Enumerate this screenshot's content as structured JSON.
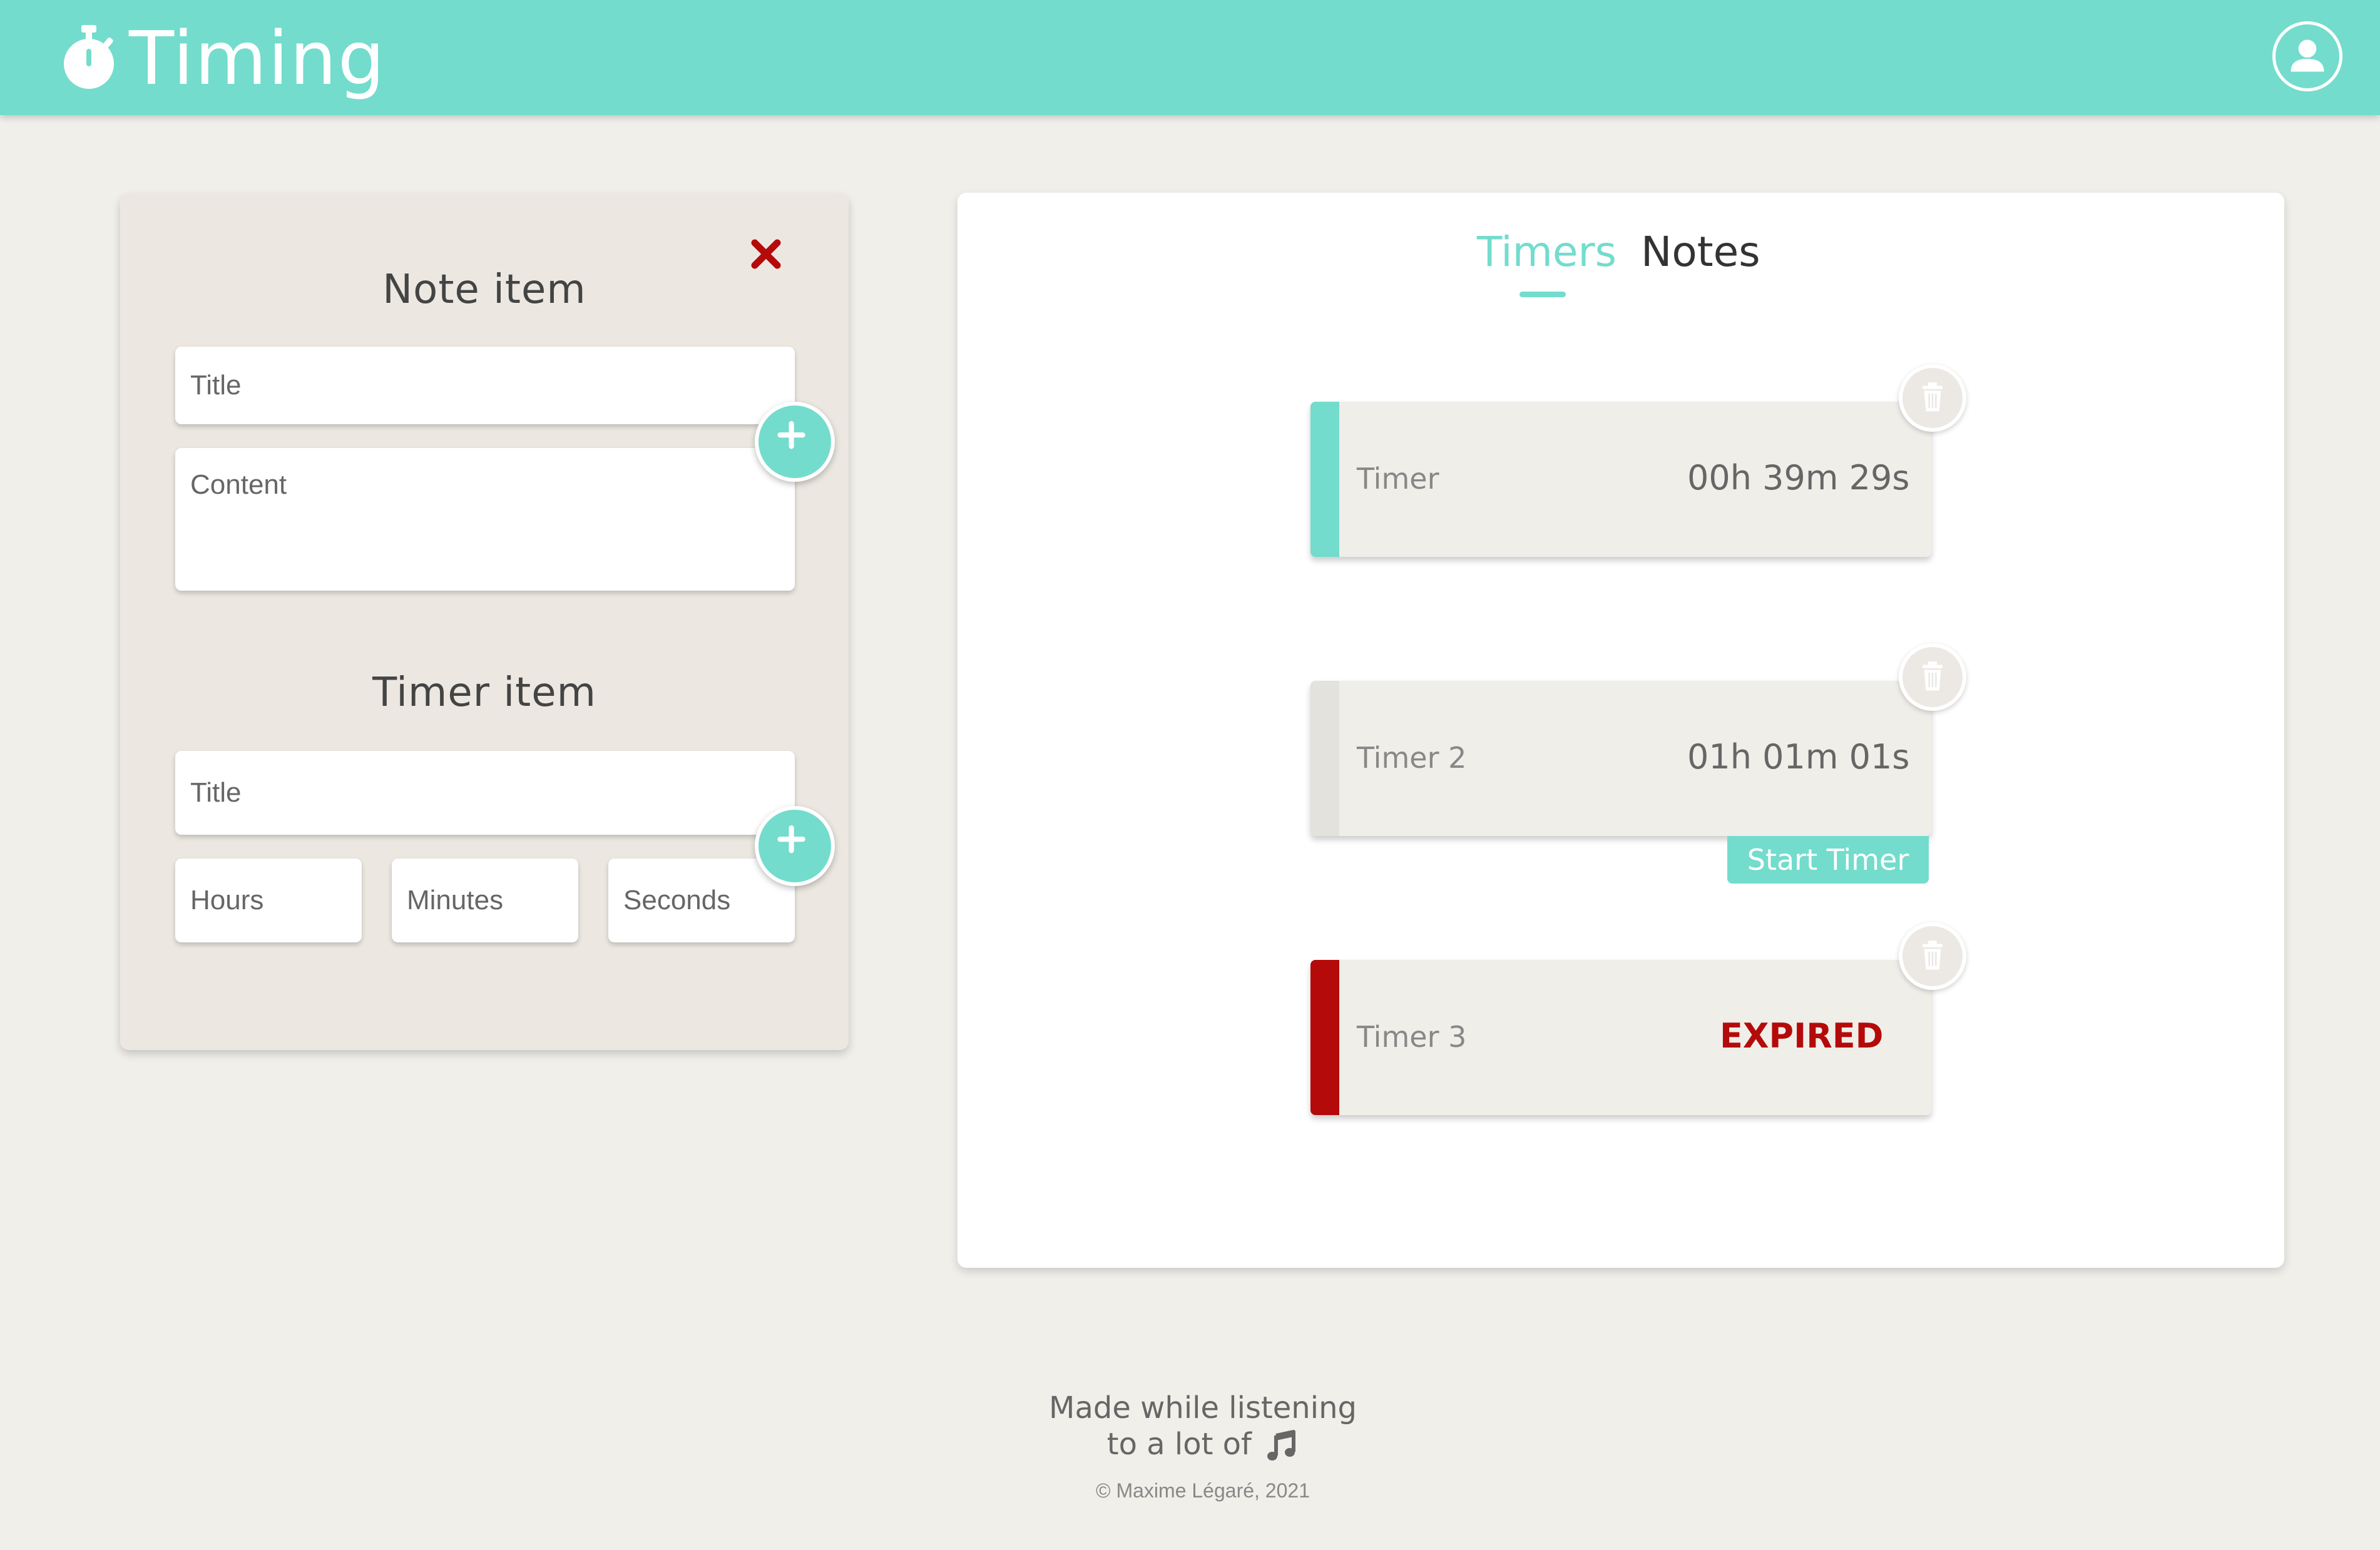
{
  "header": {
    "title": "Timing",
    "logo_icon": "stopwatch-icon",
    "account_icon": "user-icon"
  },
  "colors": {
    "accent": "#73dccd",
    "background": "#f0efea",
    "panel": "#ece8e1",
    "expired": "#b50a0a"
  },
  "form": {
    "close_icon": "close-icon",
    "note_section": {
      "title": "Note item",
      "title_placeholder": "Title",
      "content_placeholder": "Content",
      "add_icon": "plus-icon"
    },
    "timer_section": {
      "title": "Timer item",
      "title_placeholder": "Title",
      "hours_placeholder": "Hours",
      "minutes_placeholder": "Minutes",
      "seconds_placeholder": "Seconds",
      "add_icon": "plus-icon"
    }
  },
  "list": {
    "tabs": [
      {
        "label": "Timers",
        "active": true
      },
      {
        "label": "Notes",
        "active": false
      }
    ],
    "timers": [
      {
        "name": "Timer",
        "value": "00h 39m 29s",
        "status": "running",
        "stripe_color": "#73dccd"
      },
      {
        "name": "Timer 2",
        "value": "01h 01m 01s",
        "status": "stopped",
        "stripe_color": "#e4e2dd",
        "action_label": "Start Timer"
      },
      {
        "name": "Timer 3",
        "value": "EXPIRED",
        "status": "expired",
        "stripe_color": "#b50a0a"
      }
    ]
  },
  "footer": {
    "line1": "Made while listening",
    "line2": "to a lot of",
    "music_icon": "music-note-icon",
    "copyright": "© Maxime Légaré, 2021"
  }
}
